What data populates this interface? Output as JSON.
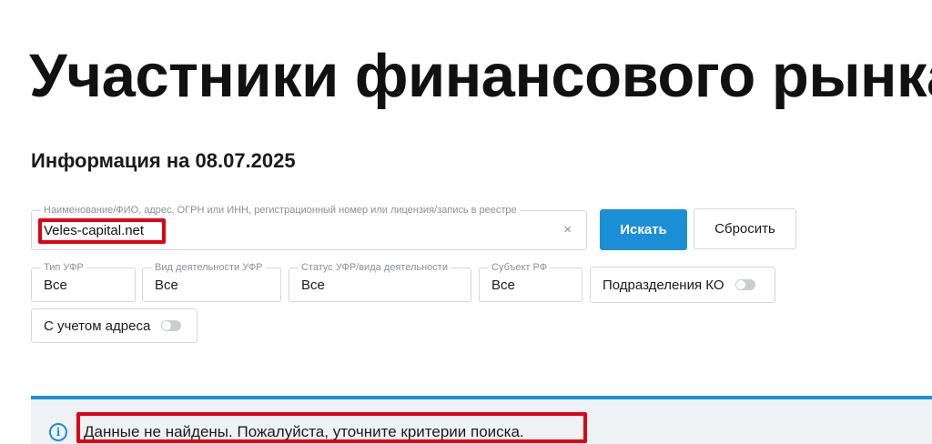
{
  "page": {
    "title": "Участники финансового рынка",
    "info_date": "Информация на 08.07.2025"
  },
  "search": {
    "label": "Наименование/ФИО, адрес, ОГРН или ИНН, регистрационный номер или лицензия/запись в реестре",
    "value": "Veles-capital.net",
    "clear_icon": "×",
    "search_button": "Искать",
    "reset_button": "Сбросить"
  },
  "filters": {
    "type": {
      "label": "Тип УФР",
      "value": "Все"
    },
    "activity": {
      "label": "Вид деятельности УФР",
      "value": "Все"
    },
    "status": {
      "label": "Статус УФР/вида деятельности",
      "value": "Все"
    },
    "region": {
      "label": "Субъект РФ",
      "value": "Все"
    }
  },
  "toggles": {
    "ko_divisions": {
      "label": "Подразделения КО",
      "on": false
    },
    "with_address": {
      "label": "С учетом адреса",
      "on": false
    }
  },
  "result": {
    "icon": "i",
    "message": "Данные не найдены. Пожалуйста, уточните критерии поиска."
  },
  "colors": {
    "accent": "#1b8fd6",
    "highlight": "#e00012",
    "panel_bg": "#eef2f5"
  }
}
